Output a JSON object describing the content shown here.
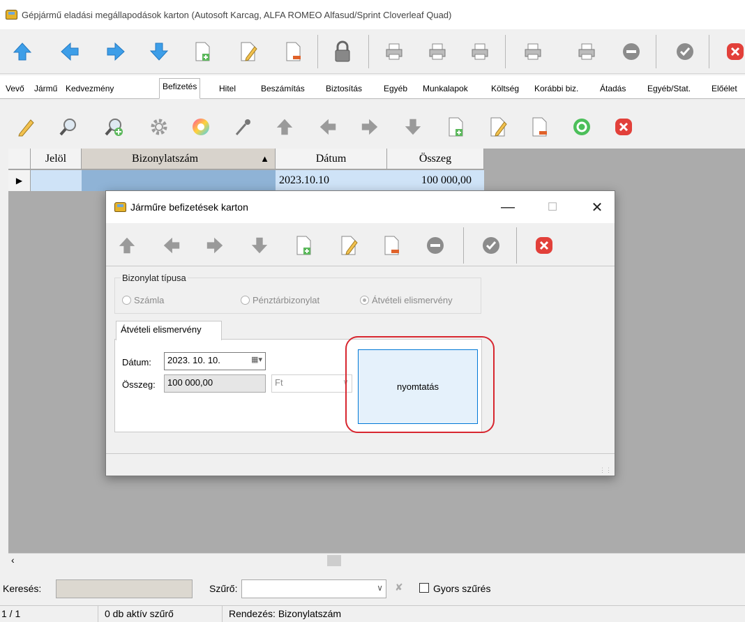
{
  "window": {
    "title": "Gépjármű eladási megállapodások karton (Autosoft Karcag, ALFA ROMEO Alfasud/Sprint Cloverleaf Quad)"
  },
  "tabs": [
    {
      "label": "Vevő"
    },
    {
      "label": "Jármű"
    },
    {
      "label": "Kedvezmény"
    },
    {
      "label": "Befizetés"
    },
    {
      "label": "Hitel"
    },
    {
      "label": "Beszámítás"
    },
    {
      "label": "Biztosítás"
    },
    {
      "label": "Egyéb"
    },
    {
      "label": "Munkalapok"
    },
    {
      "label": "Költség"
    },
    {
      "label": "Korábbi biz."
    },
    {
      "label": "Átadás"
    },
    {
      "label": "Egyéb/Stat."
    },
    {
      "label": "Előélet"
    }
  ],
  "grid": {
    "columns": [
      "Jelöl",
      "Bizonylatszám",
      "Dátum",
      "Összeg"
    ],
    "sort_indicator": "▲",
    "row_indicator": "▶",
    "rows": [
      {
        "jelol": "",
        "bizonylatszam": "",
        "datum": "2023.10.10",
        "osszeg": "100 000,00"
      }
    ]
  },
  "search": {
    "label": "Keresés:",
    "filter_label": "Szűrő:",
    "quick_filter_label": "Gyors szűrés"
  },
  "status": {
    "position": "1 / 1",
    "active_filters": "0 db aktív szűrő",
    "sorting": "Rendezés: Bizonylatszám"
  },
  "dialog": {
    "title": "Járműre befizetések karton",
    "group_title": "Bizonylat típusa",
    "radios": [
      "Számla",
      "Pénztárbizonylat",
      "Átvételi elismervény"
    ],
    "selected_radio": "Átvételi elismervény",
    "tab_label": "Átvételi elismervény",
    "date_label": "Dátum:",
    "date_value": "2023. 10. 10.",
    "amount_label": "Összeg:",
    "amount_value": "100 000,00",
    "currency_placeholder": "Ft",
    "print_label": "nyomtatás"
  },
  "colors": {
    "accent": "#0078d7",
    "highlight": "#d7262f",
    "grid_bg": "#ababab",
    "selected_cell": "#cfe3f7"
  }
}
